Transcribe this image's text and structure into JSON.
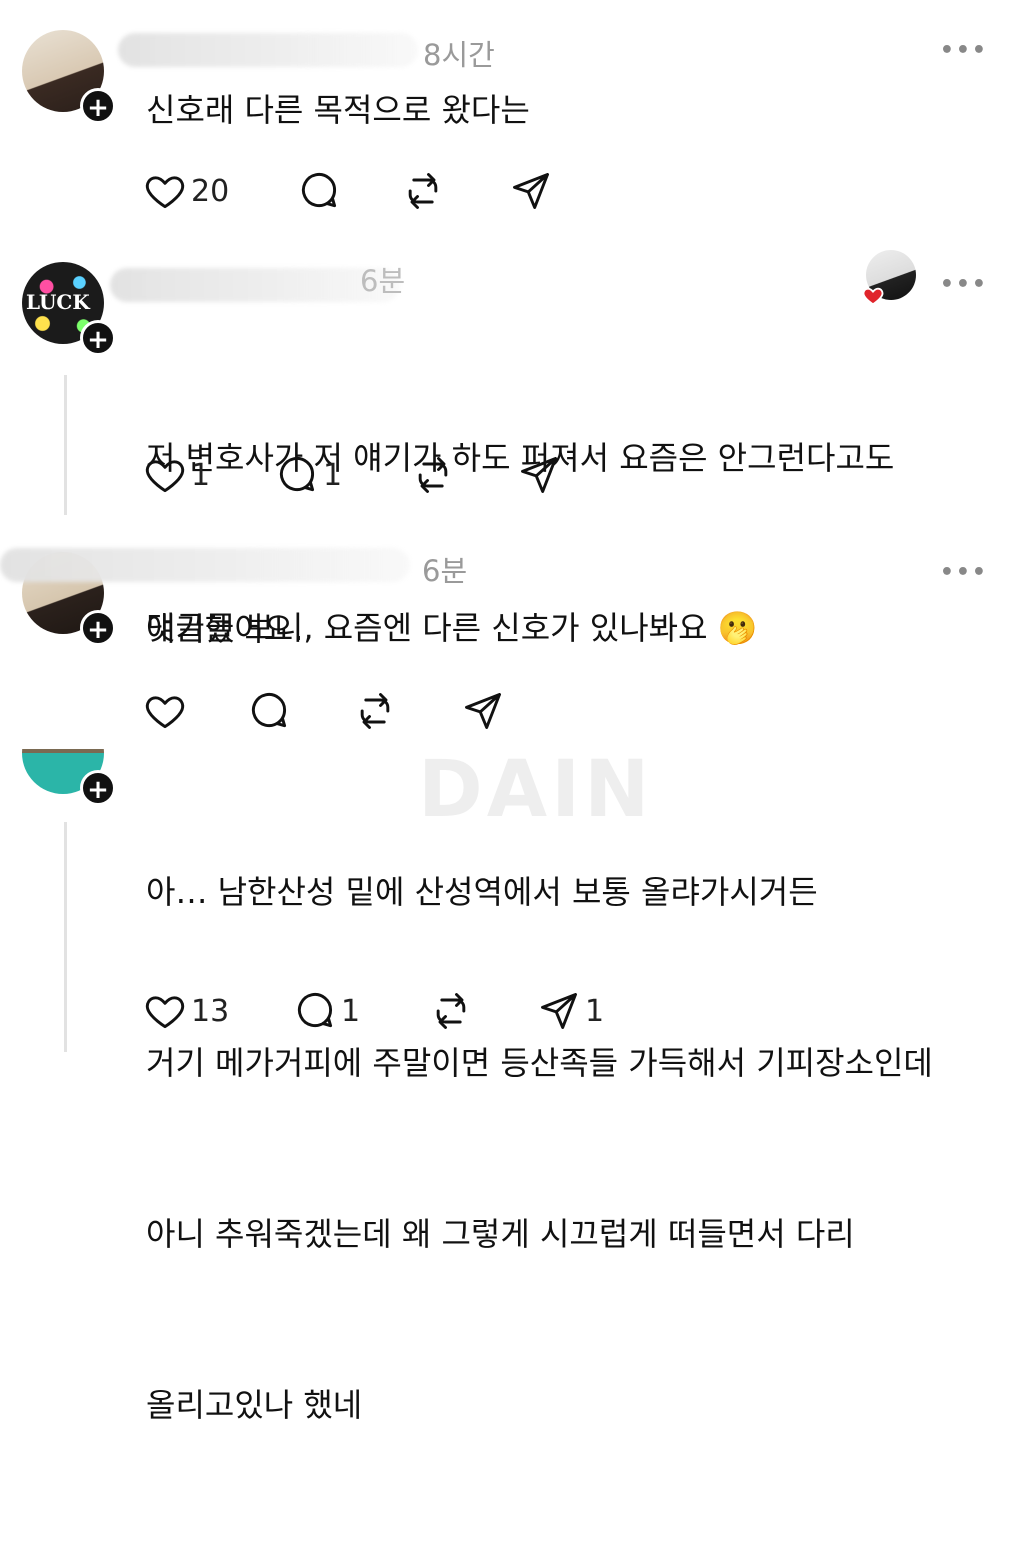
{
  "watermark": "DAIN",
  "more_label": "•••",
  "posts": [
    {
      "time": "8시간",
      "lines": [
        "신호래 다른 목적으로 왔다는"
      ],
      "likes": "20",
      "replies": "",
      "reposts": "",
      "shares": ""
    },
    {
      "time": "6분",
      "lines": [
        "저 변호사가 저 얘기가 하도 퍼져서 요즘은 안그런다고도",
        "얘기했어요."
      ],
      "avatar_text": "LUCK",
      "likes": "1",
      "replies": "1",
      "reposts": "",
      "shares": ""
    },
    {
      "time": "6분",
      "lines": [
        "댓글들 보니, 요즘엔 다른 신호가 있나봐요 🫢"
      ],
      "likes": "",
      "replies": "",
      "reposts": "",
      "shares": ""
    },
    {
      "time": "",
      "lines": [
        "아… 남한산성 밑에 산성역에서 보통 올랴가시거든",
        "거기 메가거피에 주말이면 등산족들 가득해서 기피장소인데",
        "아니 추워죽겠는데 왜 그렇게 시끄럽게 떠들면서 다리",
        "올리고있나 했네"
      ],
      "likes": "13",
      "replies": "1",
      "reposts": "",
      "shares": "1"
    }
  ],
  "colors": {
    "text": "#111111",
    "muted": "#9a9a9a",
    "heart_red": "#e0242b",
    "teal": "#2bb5a8"
  }
}
